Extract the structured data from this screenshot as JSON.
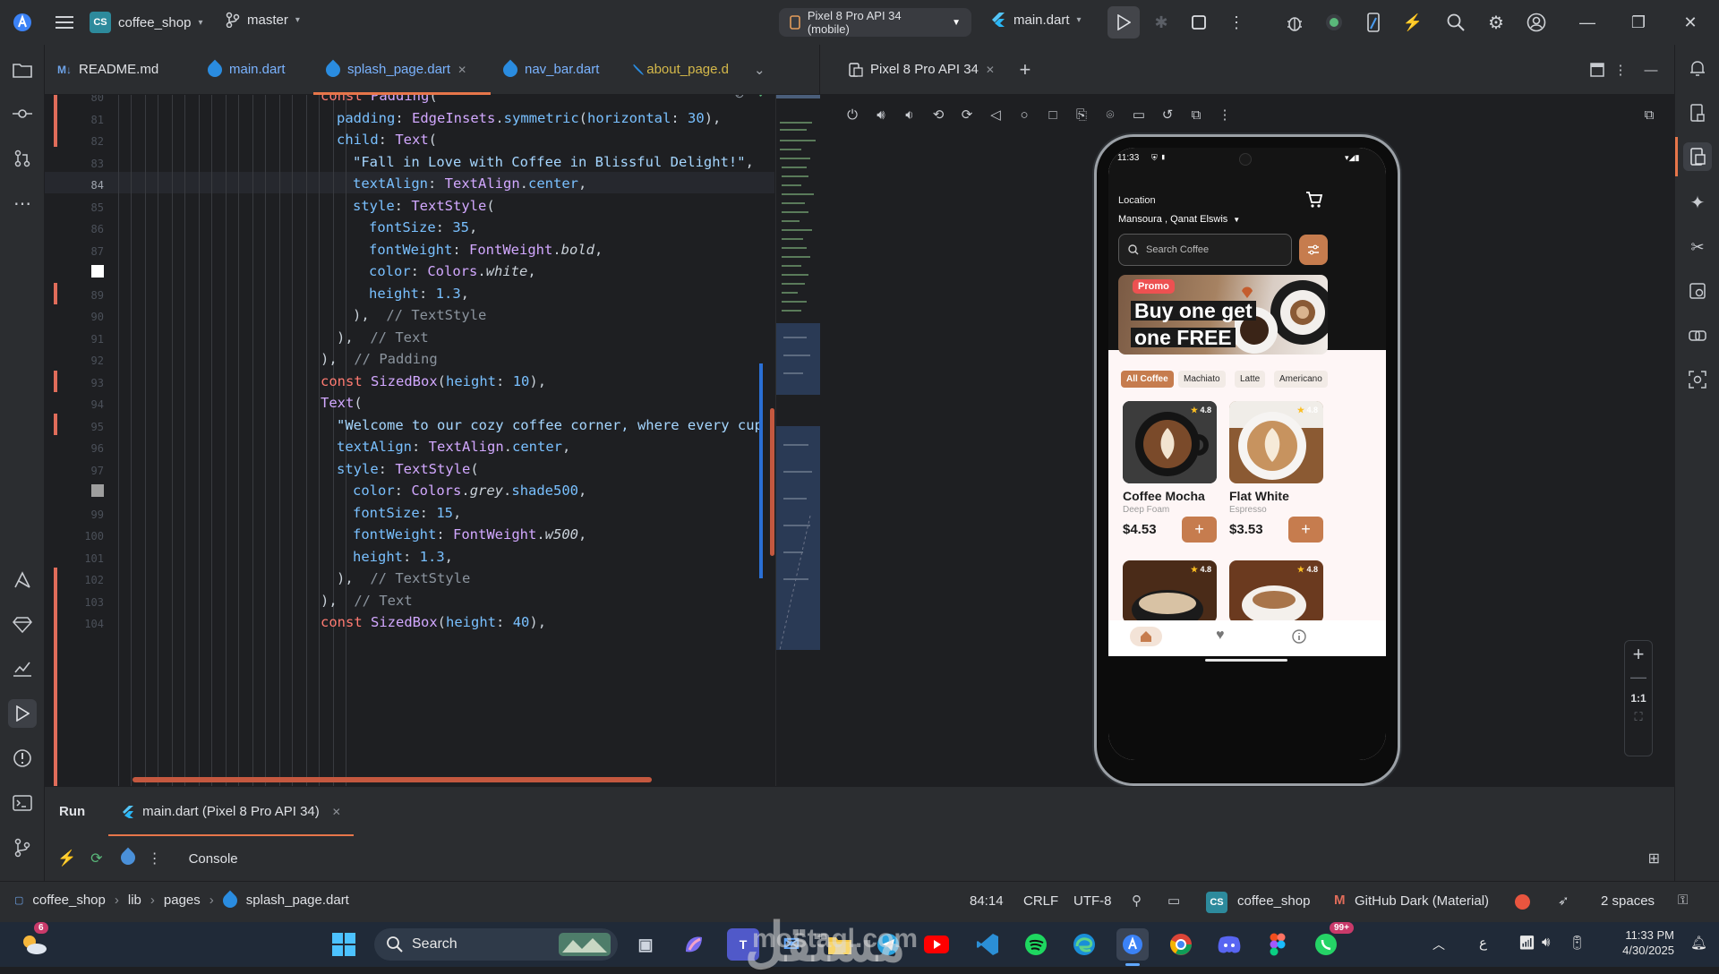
{
  "titlebar": {
    "project_initials": "CS",
    "project_name": "coffee_shop",
    "branch": "master",
    "device": "Pixel 8 Pro API 34 (mobile)",
    "run_config": "main.dart"
  },
  "editor_tabs": [
    {
      "label": "README.md"
    },
    {
      "label": "main.dart"
    },
    {
      "label": "splash_page.dart"
    },
    {
      "label": "nav_bar.dart"
    },
    {
      "label": "about_page.d"
    }
  ],
  "emulator": {
    "tab_label": "Pixel 8 Pro API 34",
    "zoom_label": "1:1"
  },
  "editor": {
    "line_numbers": [
      "80",
      "81",
      "82",
      "83",
      "84",
      "85",
      "86",
      "87",
      "88",
      "89",
      "90",
      "91",
      "92",
      "93",
      "94",
      "95",
      "96",
      "97",
      "98",
      "99",
      "100",
      "101",
      "102",
      "103",
      "104"
    ]
  },
  "app": {
    "status_time": "11:33",
    "location_label": "Location",
    "location_value": "Mansoura , Qanat Elswis",
    "search_placeholder": "Search Coffee",
    "promo_badge": "Promo",
    "promo_line1": "Buy one get",
    "promo_line2": "one FREE",
    "categories": [
      "All Coffee",
      "Machiato",
      "Latte",
      "Americano"
    ],
    "products": [
      {
        "name": "Coffee Mocha",
        "subtitle": "Deep Foam",
        "price": "$4.53",
        "rating": "4.8"
      },
      {
        "name": "Flat White",
        "subtitle": "Espresso",
        "price": "$3.53",
        "rating": "4.8"
      },
      {
        "rating": "4.8"
      },
      {
        "rating": "4.8"
      }
    ]
  },
  "run_panel": {
    "run_label": "Run",
    "run_tab": "main.dart (Pixel 8 Pro API 34)",
    "console_label": "Console"
  },
  "statusbar": {
    "breadcrumb": [
      "coffee_shop",
      "lib",
      "pages",
      "splash_page.dart"
    ],
    "position": "84:14",
    "line_sep": "CRLF",
    "encoding": "UTF-8",
    "project_initials": "CS",
    "project": "coffee_shop",
    "theme": "GitHub Dark (Material)",
    "indent": "2 spaces"
  },
  "taskbar": {
    "weather_badge": "6",
    "search_label": "Search",
    "watermark_brand": "مستقل",
    "watermark_url": "mostaql.com",
    "whatsapp_badge": "99+",
    "lang": "ع",
    "time": "11:33 PM",
    "date": "4/30/2025"
  },
  "colors": {
    "accent": "#c67c4e",
    "tab_underline": "#e7764a",
    "ide_bg": "#1e1f22",
    "panel_bg": "#2b2d30"
  }
}
